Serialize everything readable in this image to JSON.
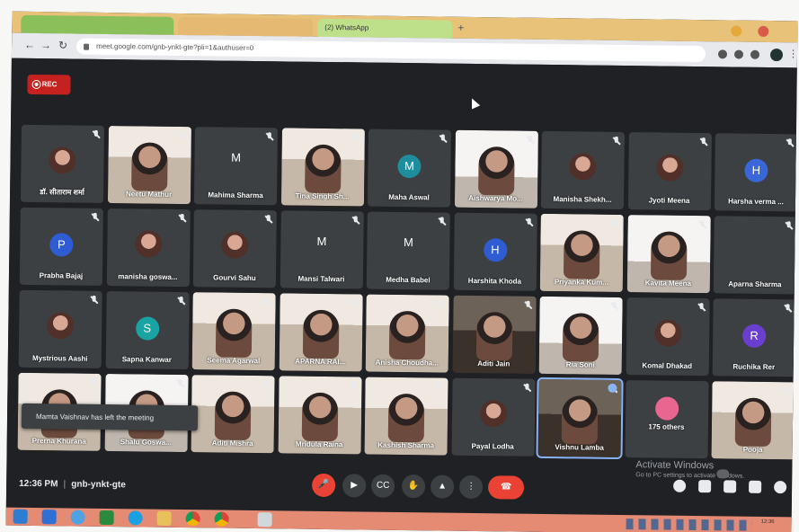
{
  "browser": {
    "tabs": [
      {
        "label": ""
      },
      {
        "label": ""
      },
      {
        "label": "(2) WhatsApp"
      }
    ],
    "url": "meet.google.com/gnb-ynkt-gte?pli=1&authuser=0"
  },
  "meet": {
    "rec_label": "REC",
    "toast": "Mamta Vaishnav has left the meeting",
    "meeting_time": "12:36 PM",
    "meeting_code": "gnb-ynkt-gte",
    "others_label": "175 others"
  },
  "participants": [
    {
      "name": "डॉ. सीताराम शर्मा",
      "kind": "photo-avatar"
    },
    {
      "name": "Neetu Mathur",
      "kind": "video"
    },
    {
      "name": "Mahima Sharma",
      "kind": "initial",
      "initial": "M"
    },
    {
      "name": "Tina Singh Sh...",
      "kind": "video"
    },
    {
      "name": "Maha Aswal",
      "kind": "initial-circle",
      "initial": "M",
      "color": "#1e8e9e"
    },
    {
      "name": "Aishwarya Mo...",
      "kind": "video-white"
    },
    {
      "name": "Manisha Shekh...",
      "kind": "photo-avatar"
    },
    {
      "name": "Jyoti Meena",
      "kind": "photo-avatar"
    },
    {
      "name": "Harsha verma ...",
      "kind": "initial-circle",
      "initial": "H",
      "color": "#3a67d8"
    },
    {
      "name": "Prabha Bajaj",
      "kind": "initial-circle",
      "initial": "P",
      "color": "#2f5bd3"
    },
    {
      "name": "manisha goswa...",
      "kind": "photo-avatar"
    },
    {
      "name": "Gourvi Sahu",
      "kind": "photo-avatar"
    },
    {
      "name": "Mansi Talwari",
      "kind": "initial",
      "initial": "M"
    },
    {
      "name": "Medha Babel",
      "kind": "initial",
      "initial": "M"
    },
    {
      "name": "Harshita Khoda",
      "kind": "initial-circle",
      "initial": "H",
      "color": "#2f5bd3"
    },
    {
      "name": "Priyanka Kum...",
      "kind": "video"
    },
    {
      "name": "Kavita Meena",
      "kind": "video-white"
    },
    {
      "name": "Aparna Sharma",
      "kind": "blank"
    },
    {
      "name": "Mystrious Aashi",
      "kind": "photo-avatar"
    },
    {
      "name": "Sapna Kanwar",
      "kind": "initial-circle",
      "initial": "S",
      "color": "#1aa3a3"
    },
    {
      "name": "Seema Agarwal",
      "kind": "video"
    },
    {
      "name": "APARNA RAI...",
      "kind": "video"
    },
    {
      "name": "Anisha Choudha...",
      "kind": "video"
    },
    {
      "name": "Aditi Jain",
      "kind": "video-dark"
    },
    {
      "name": "Ria Soni",
      "kind": "video-white"
    },
    {
      "name": "Komal Dhakad",
      "kind": "photo-avatar"
    },
    {
      "name": "Ruchika Rer",
      "kind": "initial-circle",
      "initial": "R",
      "color": "#6a3fd0"
    },
    {
      "name": "Prerna Khurana",
      "kind": "video"
    },
    {
      "name": "Shalu Goswa...",
      "kind": "video-white"
    },
    {
      "name": "Aditi Mishra",
      "kind": "video"
    },
    {
      "name": "Mridula Raina",
      "kind": "video"
    },
    {
      "name": "Kashish Sharma",
      "kind": "video"
    },
    {
      "name": "Payal Lodha",
      "kind": "photo-avatar"
    },
    {
      "name": "Vishnu Lamba",
      "kind": "video-dark"
    },
    {
      "name": "175 others",
      "kind": "others"
    },
    {
      "name": "Pooja",
      "kind": "video"
    }
  ],
  "taskbar_clock": {
    "time": "12:36",
    "date": ""
  },
  "watermark": {
    "title": "Activate Windows",
    "subtitle": "Go to PC settings to activate Windows."
  }
}
